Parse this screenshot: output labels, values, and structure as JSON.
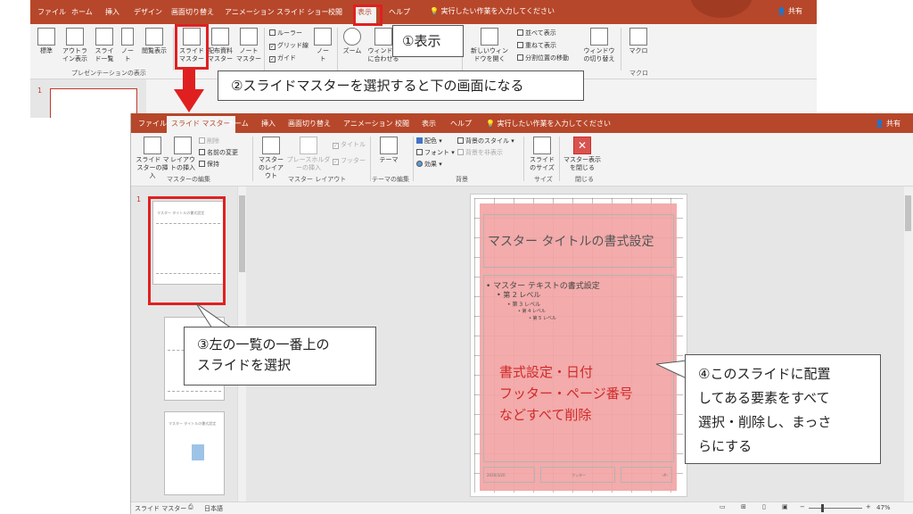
{
  "back_window": {
    "tabs": [
      "ファイル",
      "ホーム",
      "挿入",
      "デザイン",
      "画面切り替え",
      "アニメーション",
      "スライド ショー",
      "校閲",
      "表示",
      "ヘルプ"
    ],
    "selected_tab": "表示",
    "tell_me": "実行したい作業を入力してください",
    "share": "共有",
    "ribbon": {
      "normal": "標準",
      "outline": "アウトライン表示",
      "slide_sorter": "スライド一覧",
      "notes": "ノート",
      "reading": "閲覧表示",
      "slide_master": "スライド マスター",
      "handout_master": "配布資料マスター",
      "notes_master": "ノート マスター",
      "group_presentation_views": "プレゼンテーションの表示",
      "ruler": "ルーラー",
      "gridlines": "グリッド線",
      "guides": "ガイド",
      "notes2": "ノート",
      "zoom": "ズーム",
      "fit_window": "ウィンドウに合わせる",
      "new_window": "新しいウィンドウを開く",
      "arrange_all": "並べて表示",
      "cascade": "重ねて表示",
      "split": "分割位置の移動",
      "switch_windows": "ウィンドウの切り替え",
      "macros": "マクロ",
      "group_macros": "マクロ"
    },
    "slide_number": "1"
  },
  "front_window": {
    "tabs": [
      "ファイル",
      "スライド マスター",
      "ホーム",
      "挿入",
      "画面切り替え",
      "アニメーション",
      "校閲",
      "表示",
      "ヘルプ"
    ],
    "selected_tab": "スライド マスター",
    "tell_me": "実行したい作業を入力してください",
    "share": "共有",
    "ribbon": {
      "insert_slide_master": "スライド マスターの挿入",
      "insert_layout": "レイアウトの挿入",
      "delete": "削除",
      "rename": "名前の変更",
      "preserve": "保持",
      "group_edit_master": "マスターの編集",
      "master_layout": "マスターのレイアウト",
      "insert_placeholder": "プレースホルダーの挿入",
      "title_check": "タイトル",
      "footer_check": "フッター",
      "group_master_layout": "マスター レイアウト",
      "themes": "テーマ",
      "group_edit_theme": "テーマの編集",
      "colors": "配色",
      "fonts": "フォント",
      "effects": "効果",
      "background_styles": "背景のスタイル",
      "hide_background": "背景を非表示",
      "group_background": "背景",
      "slide_size": "スライドのサイズ",
      "group_size": "サイズ",
      "close_master": "マスター表示を閉じる",
      "group_close": "閉じる"
    },
    "slide_number": "1",
    "slide": {
      "title": "マスター タイトルの書式設定",
      "thumb_title": "マスター タイトルの書式設定",
      "levels": [
        "• マスター テキストの書式設定",
        "• 第 2 レベル",
        "• 第 3 レベル",
        "• 第 4 レベル",
        "• 第 5 レベル"
      ],
      "footer_date": "2020/3/20",
      "footer_text": "フッター",
      "footer_num": "‹#›",
      "note_lines": [
        "書式設定・日付",
        "フッター・ページ番号",
        "などすべて削除"
      ]
    },
    "status": {
      "view": "スライド マスター",
      "lang": "日本語",
      "zoom": "47%"
    }
  },
  "annotations": {
    "step1": "①表示",
    "step2": "②スライドマスターを選択すると下の画面になる",
    "step3": [
      "③左の一覧の一番上の",
      "スライドを選択"
    ],
    "step4": [
      "④このスライドに配置",
      "してある要素をすべて",
      "選択・削除し、まっさ",
      "らにする"
    ]
  },
  "colors": {
    "accent": "#b7472a",
    "highlight": "#e02020",
    "pink": "#f2a4a4"
  }
}
